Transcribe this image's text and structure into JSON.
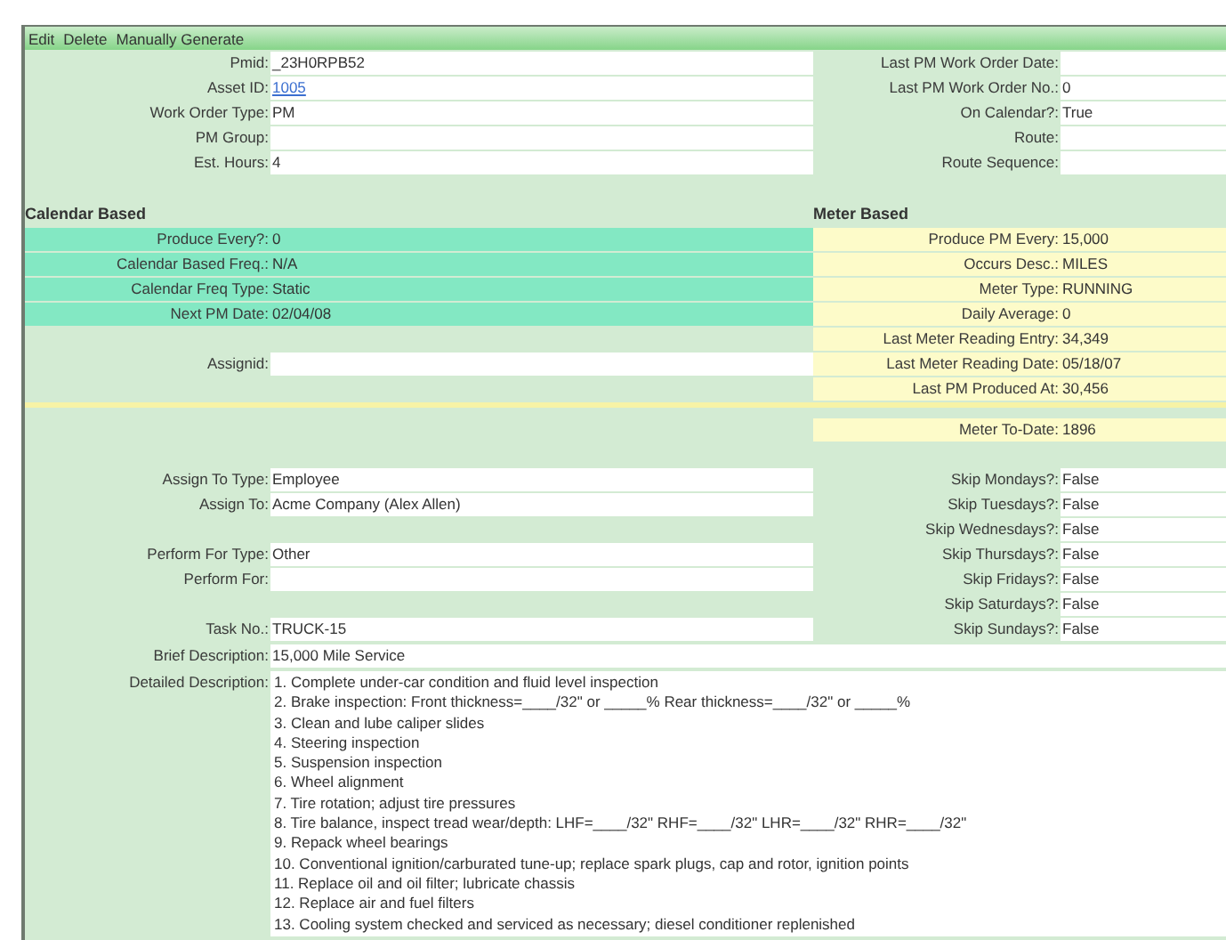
{
  "menu": [
    {
      "label": "Edit"
    },
    {
      "label": "Delete"
    },
    {
      "label": "Manually Generate"
    }
  ],
  "rows": [
    {
      "kind": "fields",
      "left": {
        "kind": "field",
        "label": "Pmid:",
        "value": "_23H0RPB52"
      },
      "right": {
        "kind": "field",
        "label": "Last PM Work Order Date:"
      }
    },
    {
      "kind": "fields",
      "left": {
        "kind": "field",
        "label": "Asset ID:",
        "value": "1005",
        "link": true
      },
      "right": {
        "kind": "field",
        "label": "Last PM Work Order No.:",
        "value": "0"
      }
    },
    {
      "kind": "fields",
      "left": {
        "kind": "field",
        "label": "Work Order Type:",
        "value": "PM"
      },
      "right": {
        "kind": "field",
        "label": "On Calendar?:",
        "value": "True"
      }
    },
    {
      "kind": "fields",
      "left": {
        "kind": "field",
        "label": "PM Group:"
      },
      "right": {
        "kind": "field",
        "label": "Route:"
      }
    },
    {
      "kind": "fields",
      "left": {
        "kind": "field",
        "label": "Est. Hours:",
        "value": "4"
      },
      "right": {
        "kind": "field",
        "label": "Route Sequence:"
      }
    },
    {
      "kind": "spacer"
    },
    {
      "kind": "heading",
      "left": "Calendar Based",
      "right": "Meter Based"
    },
    {
      "kind": "fields",
      "left": {
        "kind": "calendar",
        "label": "Produce Every?:",
        "value": "0"
      },
      "right": {
        "kind": "meter",
        "label": "Produce PM Every:",
        "value": "15,000"
      }
    },
    {
      "kind": "fields",
      "left": {
        "kind": "calendar",
        "label": "Calendar Based Freq.:",
        "value": "N/A"
      },
      "right": {
        "kind": "meter",
        "label": "Occurs Desc.:",
        "value": "MILES"
      }
    },
    {
      "kind": "fields",
      "left": {
        "kind": "calendar",
        "label": "Calendar Freq Type:",
        "value": "Static"
      },
      "right": {
        "kind": "meter",
        "label": "Meter Type:",
        "value": "RUNNING"
      }
    },
    {
      "kind": "fields",
      "left": {
        "kind": "calendar",
        "label": "Next PM Date:",
        "value": "02/04/08"
      },
      "right": {
        "kind": "meter",
        "label": "Daily Average:",
        "value": "0"
      }
    },
    {
      "kind": "fields",
      "left": null,
      "right": {
        "kind": "meter",
        "label": "Last Meter Reading Entry:",
        "value": "34,349"
      }
    },
    {
      "kind": "fields",
      "left": {
        "kind": "field",
        "label": "Assignid:"
      },
      "right": {
        "kind": "meter",
        "label": "Last Meter Reading Date:",
        "value": "05/18/07"
      }
    },
    {
      "kind": "fields",
      "left": null,
      "right": {
        "kind": "meter",
        "label": "Last PM Produced At:",
        "value": "30,456"
      }
    },
    {
      "kind": "divider"
    },
    {
      "kind": "fields",
      "left": null,
      "right": {
        "kind": "meter",
        "label": "Meter To-Date:",
        "value": "1896"
      }
    },
    {
      "kind": "spacer"
    },
    {
      "kind": "fields",
      "left": {
        "kind": "field",
        "label": "Assign To Type:",
        "value": "Employee"
      },
      "right": {
        "kind": "field",
        "label": "Skip Mondays?:",
        "value": "False"
      }
    },
    {
      "kind": "fields",
      "left": {
        "kind": "field",
        "label": "Assign To:",
        "value": "Acme Company (Alex Allen)"
      },
      "right": {
        "kind": "field",
        "label": "Skip Tuesdays?:",
        "value": "False"
      }
    },
    {
      "kind": "fields",
      "left": null,
      "right": {
        "kind": "field",
        "label": "Skip Wednesdays?:",
        "value": "False"
      }
    },
    {
      "kind": "fields",
      "left": {
        "kind": "field",
        "label": "Perform For Type:",
        "value": "Other"
      },
      "right": {
        "kind": "field",
        "label": "Skip Thursdays?:",
        "value": "False"
      }
    },
    {
      "kind": "fields",
      "left": {
        "kind": "field",
        "label": "Perform For:"
      },
      "right": {
        "kind": "field",
        "label": "Skip Fridays?:",
        "value": "False"
      }
    },
    {
      "kind": "fields",
      "left": null,
      "right": {
        "kind": "field",
        "label": "Skip Saturdays?:",
        "value": "False"
      }
    },
    {
      "kind": "fields",
      "left": {
        "kind": "field",
        "label": "Task No.:",
        "value": "TRUCK-15"
      },
      "right": {
        "kind": "field",
        "label": "Skip Sundays?:",
        "value": "False"
      }
    },
    {
      "kind": "wide",
      "label": "Brief Description:",
      "value": "15,000 Mile Service"
    },
    {
      "kind": "multiline",
      "label": "Detailed Description:",
      "lines": [
        "1. Complete under-car condition and fluid level inspection",
        "2. Brake inspection: Front thickness=____/32\" or _____% Rear thickness=____/32\" or _____%",
        "3. Clean and lube caliper slides",
        "4. Steering inspection",
        "5. Suspension inspection",
        "6. Wheel alignment",
        "7. Tire rotation; adjust tire pressures",
        "8. Tire balance, inspect tread wear/depth: LHF=____/32\" RHF=____/32\" LHR=____/32\" RHR=____/32\"",
        "9. Repack wheel bearings",
        "10. Conventional ignition/carburated tune-up; replace spark plugs, cap and rotor, ignition points",
        "11. Replace oil and oil filter; lubricate chassis",
        "12. Replace air and fuel filters",
        "13. Cooling system checked and serviced as necessary; diesel conditioner replenished"
      ]
    }
  ]
}
